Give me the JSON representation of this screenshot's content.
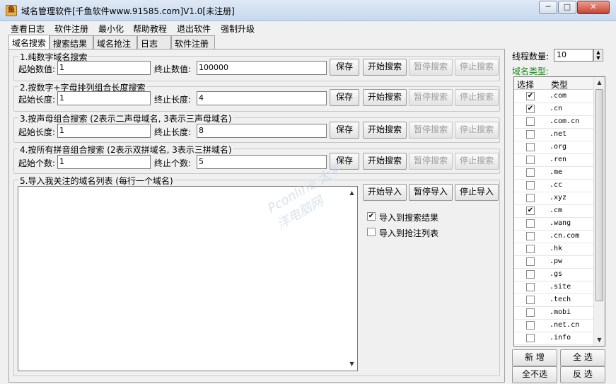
{
  "window": {
    "icon_glyph": "鱼",
    "title": "域名管理软件[千鱼软件www.91585.com]V1.0[未注册]",
    "min_glyph": "─",
    "max_glyph": "□",
    "close_glyph": "✕"
  },
  "menu": [
    "查看日志",
    "软件注册",
    "最小化",
    "帮助教程",
    "退出软件",
    "强制升级"
  ],
  "tabs": [
    "域名搜索",
    "搜索结果",
    "域名抢注",
    "日志",
    "软件注册"
  ],
  "groups": {
    "g1": {
      "legend": "1.纯数字域名搜索",
      "start_label": "起始数值:",
      "start_value": "1",
      "end_label": "终止数值:",
      "end_value": "100000"
    },
    "g2": {
      "legend": "2.按数字+字母排列组合长度搜索",
      "start_label": "起始长度:",
      "start_value": "1",
      "end_label": "终止长度:",
      "end_value": "4"
    },
    "g3": {
      "legend": "3.按声母组合搜索 (2表示二声母域名, 3表示三声母域名)",
      "start_label": "起始长度:",
      "start_value": "1",
      "end_label": "终止长度:",
      "end_value": "8"
    },
    "g4": {
      "legend": "4.按所有拼音组合搜索 (2表示双拼域名, 3表示三拼域名)",
      "start_label": "起始个数:",
      "start_value": "1",
      "end_label": "终止个数:",
      "end_value": "5"
    },
    "g5": {
      "legend": "5.导入我关注的域名列表 (每行一个域名)"
    }
  },
  "buttons": {
    "save": "保存",
    "start_search": "开始搜索",
    "pause_search": "暂停搜索",
    "stop_search": "停止搜索",
    "start_import": "开始导入",
    "pause_import": "暂停导入",
    "stop_import": "停止导入"
  },
  "import_options": {
    "to_results": {
      "label": "导入到搜索结果",
      "checked": true
    },
    "to_snipe": {
      "label": "导入到抢注列表",
      "checked": false
    }
  },
  "watermark": "Pconline 太平洋电脑网",
  "threads": {
    "label": "线程数量:",
    "value": "10"
  },
  "domain_types": {
    "label": "域名类型:",
    "col_select": "选择",
    "col_type": "类型",
    "rows": [
      {
        "type": ".com",
        "checked": true
      },
      {
        "type": ".cn",
        "checked": true
      },
      {
        "type": ".com.cn",
        "checked": false
      },
      {
        "type": ".net",
        "checked": false
      },
      {
        "type": ".org",
        "checked": false
      },
      {
        "type": ".ren",
        "checked": false
      },
      {
        "type": ".me",
        "checked": false
      },
      {
        "type": ".cc",
        "checked": false
      },
      {
        "type": ".xyz",
        "checked": false
      },
      {
        "type": ".cm",
        "checked": true
      },
      {
        "type": ".wang",
        "checked": false
      },
      {
        "type": ".cn.com",
        "checked": false
      },
      {
        "type": ".hk",
        "checked": false
      },
      {
        "type": ".pw",
        "checked": false
      },
      {
        "type": ".gs",
        "checked": false
      },
      {
        "type": ".site",
        "checked": false
      },
      {
        "type": ".tech",
        "checked": false
      },
      {
        "type": ".mobi",
        "checked": false
      },
      {
        "type": ".net.cn",
        "checked": false
      },
      {
        "type": ".info",
        "checked": false
      }
    ]
  },
  "list_buttons": {
    "add": "新 增",
    "select_all": "全 选",
    "select_none": "全不选",
    "invert": "反 选"
  },
  "glyphs": {
    "check": "✔",
    "up": "▲",
    "down": "▼"
  }
}
